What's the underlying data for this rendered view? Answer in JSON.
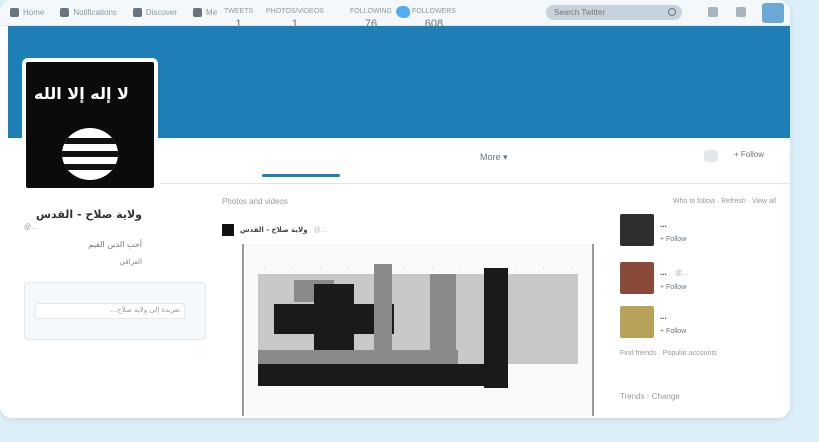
{
  "topnav": {
    "items": [
      {
        "label": "Home",
        "icon": "home-icon"
      },
      {
        "label": "Notifications",
        "icon": "bell-icon"
      },
      {
        "label": "Discover",
        "icon": "hashtag-icon"
      },
      {
        "label": "Me",
        "icon": "person-icon"
      }
    ],
    "search_placeholder": "Search Twitter"
  },
  "profile": {
    "name": "ولاية صلاح - القدس",
    "handle": "@...",
    "bio": "أحب الدين القيم",
    "location": "العراقي",
    "avatar_text": "لا إله إلا الله"
  },
  "stats": [
    {
      "label": "TWEETS",
      "value": "1"
    },
    {
      "label": "PHOTOS/VIDEOS",
      "value": "1"
    },
    {
      "label": "FOLLOWING",
      "value": "76"
    },
    {
      "label": "FOLLOWERS",
      "value": "608"
    }
  ],
  "profile_nav": {
    "more_label": "More ▾",
    "follow_label": "+ Follow"
  },
  "tweet_box": {
    "placeholder": "...تغريدة إلى ولاية صلاح"
  },
  "timeline": {
    "section_title": "Photos and videos",
    "tweet": {
      "name": "ولاية صلاح - القدس",
      "handle": "@..."
    }
  },
  "who_to_follow": {
    "title": "Who to follow · Refresh · View all",
    "items": [
      {
        "name": "...",
        "handle": "",
        "follow_label": "+ Follow",
        "color": "#2e2e2e"
      },
      {
        "name": "...",
        "handle": "@...",
        "follow_label": "+ Follow",
        "color": "#8a4a3a"
      },
      {
        "name": "...",
        "handle": "",
        "follow_label": "+ Follow",
        "color": "#b7a25a"
      }
    ],
    "links": "Find friends · Popular accounts",
    "trends_title": "Trends · Change"
  },
  "colors": {
    "banner": "#1e7fb7",
    "accent": "#55acee",
    "page_bg": "#dceef8"
  }
}
